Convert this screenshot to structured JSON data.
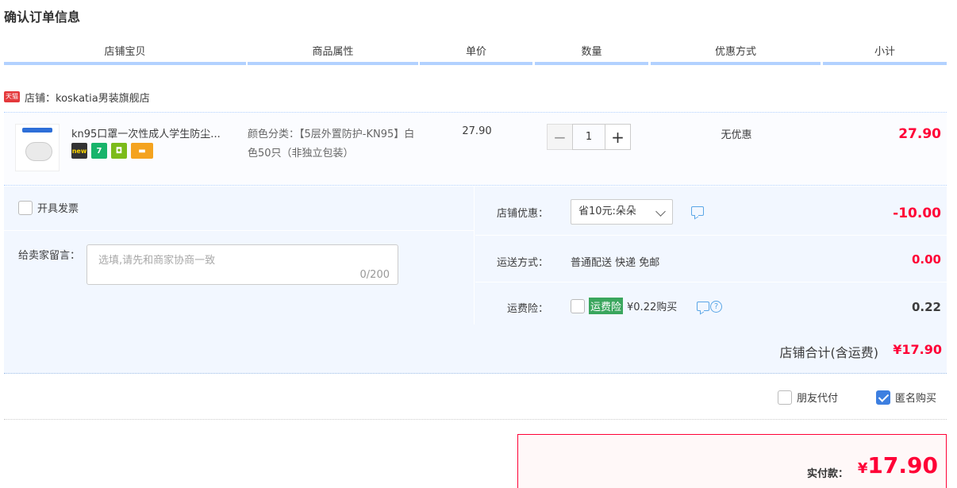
{
  "page_title": "确认订单信息",
  "columns": [
    "店铺宝贝",
    "商品属性",
    "单价",
    "数量",
    "优惠方式",
    "小计"
  ],
  "shop": {
    "badge": "天猫",
    "label": "店铺：koskatia男装旗舰店"
  },
  "item": {
    "title": "kn95口罩一次性成人学生防尘...",
    "attr_prefix": "颜色分类：",
    "attr_value": "【5层外置防护-KN95】白色50只（非独立包装）",
    "price": "27.90",
    "quantity": "1",
    "discount": "无优惠",
    "subtotal": "27.90",
    "icons": [
      "tmall-new-icon",
      "seven-day-return-icon",
      "shield-icon",
      "card-icon"
    ]
  },
  "options": {
    "invoice_label": "开具发票",
    "message_label": "给卖家留言：",
    "message_placeholder": "选填,请先和商家协商一致",
    "message_count": "0/200",
    "shop_coupon_label": "店铺优惠：",
    "shop_coupon_value": "省10元:朵朵",
    "shop_coupon_amount": "-10.00",
    "shipping_label": "运送方式：",
    "shipping_value": "普通配送 快递 免邮",
    "shipping_amount": "0.00",
    "insurance_label": "运费险：",
    "insurance_tag": "运费险",
    "insurance_price": "¥0.22购买",
    "insurance_amount": "0.22"
  },
  "shop_total": {
    "label": "店铺合计(含运费)",
    "value": "¥17.90"
  },
  "extra": {
    "friend_pay": "朋友代付",
    "anonymous": "匿名购买"
  },
  "payment": {
    "label": "实付款：",
    "currency": "¥",
    "amount": "17.90"
  },
  "colors": {
    "price_red": "#ff0036",
    "header_blue": "#b2d1ff",
    "panel_bg": "#f2f7ff"
  }
}
